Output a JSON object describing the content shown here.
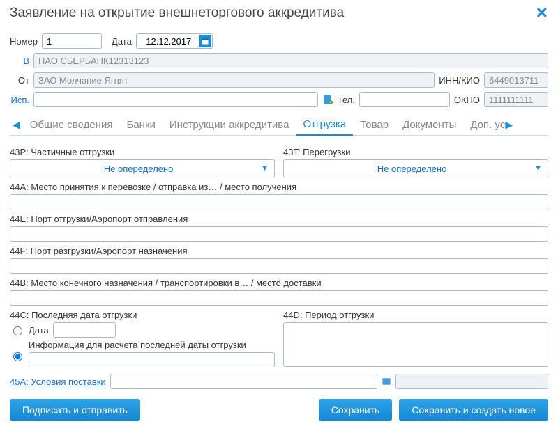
{
  "title": "Заявление на открытие внешнеторгового аккредитива",
  "header": {
    "number_label": "Номер",
    "number_value": "1",
    "date_label": "Дата",
    "date_value": "12.12.2017",
    "to_label": "В",
    "to_value": "ПАО СБЕРБАНК12313123",
    "from_label": "От",
    "from_value": "ЗАО Молчание Ягнят",
    "inn_label": "ИНН/КИО",
    "inn_value": "6449013711",
    "isp_label": "Исп.",
    "isp_value": "",
    "tel_label": "Тел.",
    "tel_value": "",
    "okpo_label": "ОКПО",
    "okpo_value": "1111111111"
  },
  "tabs": {
    "items": [
      "Общие сведения",
      "Банки",
      "Инструкции аккредитива",
      "Отгрузка",
      "Товар",
      "Документы",
      "Доп. ус"
    ],
    "active_index": 3
  },
  "shipment": {
    "f43p_label": "43P: Частичные отгрузки",
    "f43p_value": "Не опеределено",
    "f43t_label": "43T: Перегрузки",
    "f43t_value": "Не опеределено",
    "f44a_label": "44A: Место принятия к перевозке / отправка из… / место получения",
    "f44a_value": "",
    "f44e_label": "44E: Порт отгрузки/Аэропорт отправления",
    "f44e_value": "",
    "f44f_label": "44F: Порт разгрузки/Аэропорт назначения",
    "f44f_value": "",
    "f44b_label": "44B: Место конечного назначения / транспортировки в… / место доставки",
    "f44b_value": "",
    "f44c_label": "44C: Последняя дата отгрузки",
    "f44c_date_label": "Дата",
    "f44c_date_value": "",
    "f44c_calc_label": "Информация для расчета последней даты отгрузки",
    "f44c_calc_value": "",
    "f44d_label": "44D: Период отгрузки",
    "f44d_value": "",
    "f45a_label": "45A: Условия поставки",
    "f45a_value1": "",
    "f45a_value2": ""
  },
  "buttons": {
    "sign_send": "Подписать и отправить",
    "save": "Сохранить",
    "save_new": "Сохранить и создать новое"
  }
}
